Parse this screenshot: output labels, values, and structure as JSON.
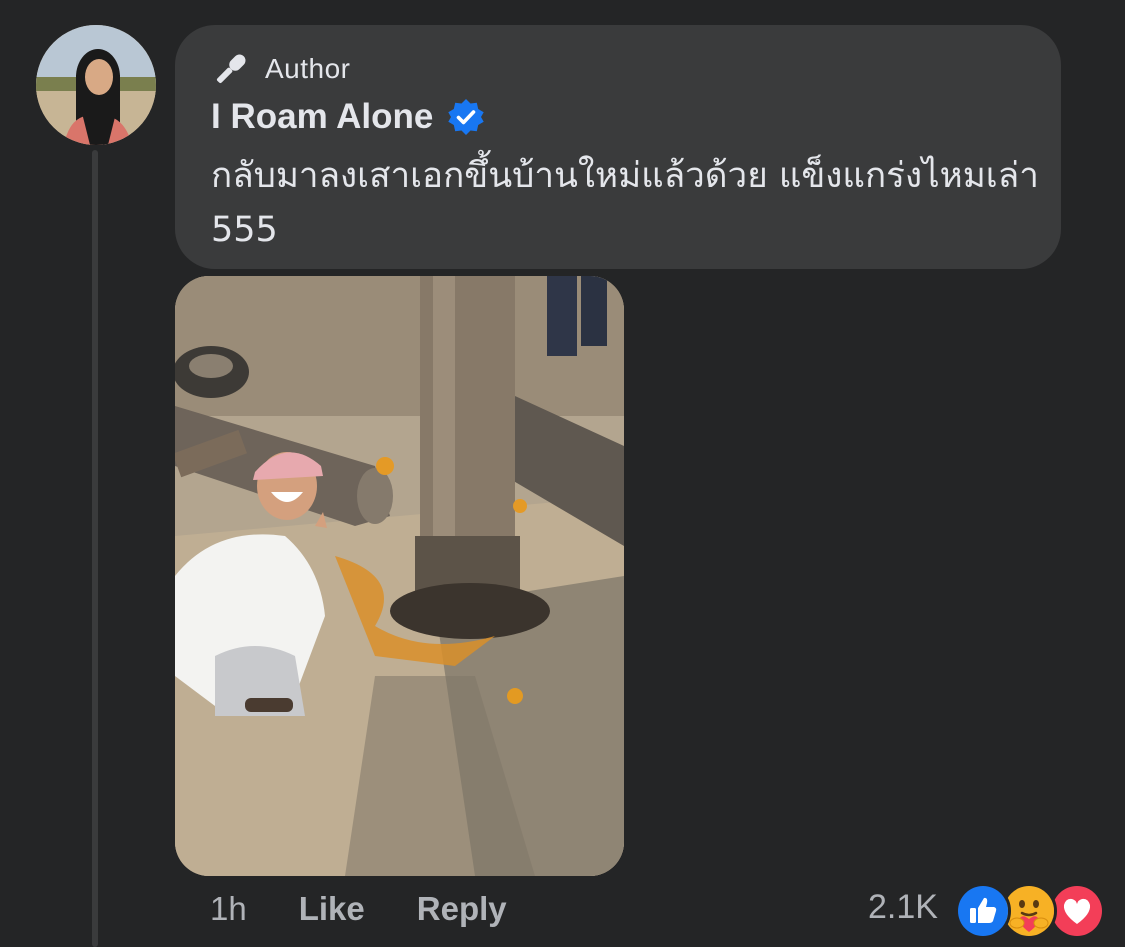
{
  "comment": {
    "badge_label": "Author",
    "author_name": "I Roam Alone",
    "text": "กลับมาลงเสาเอกขึ้นบ้านใหม่แล้วด้วย แข็งแกร่งไหมเล่า 555",
    "verified": true
  },
  "actions": {
    "time": "1h",
    "like_label": "Like",
    "reply_label": "Reply"
  },
  "reactions": {
    "count": "2.1K",
    "types": [
      "like-icon",
      "care-icon",
      "love-icon"
    ],
    "colors": {
      "like": "#1877f2",
      "love": "#f33e58",
      "care": "#f7b125"
    }
  }
}
